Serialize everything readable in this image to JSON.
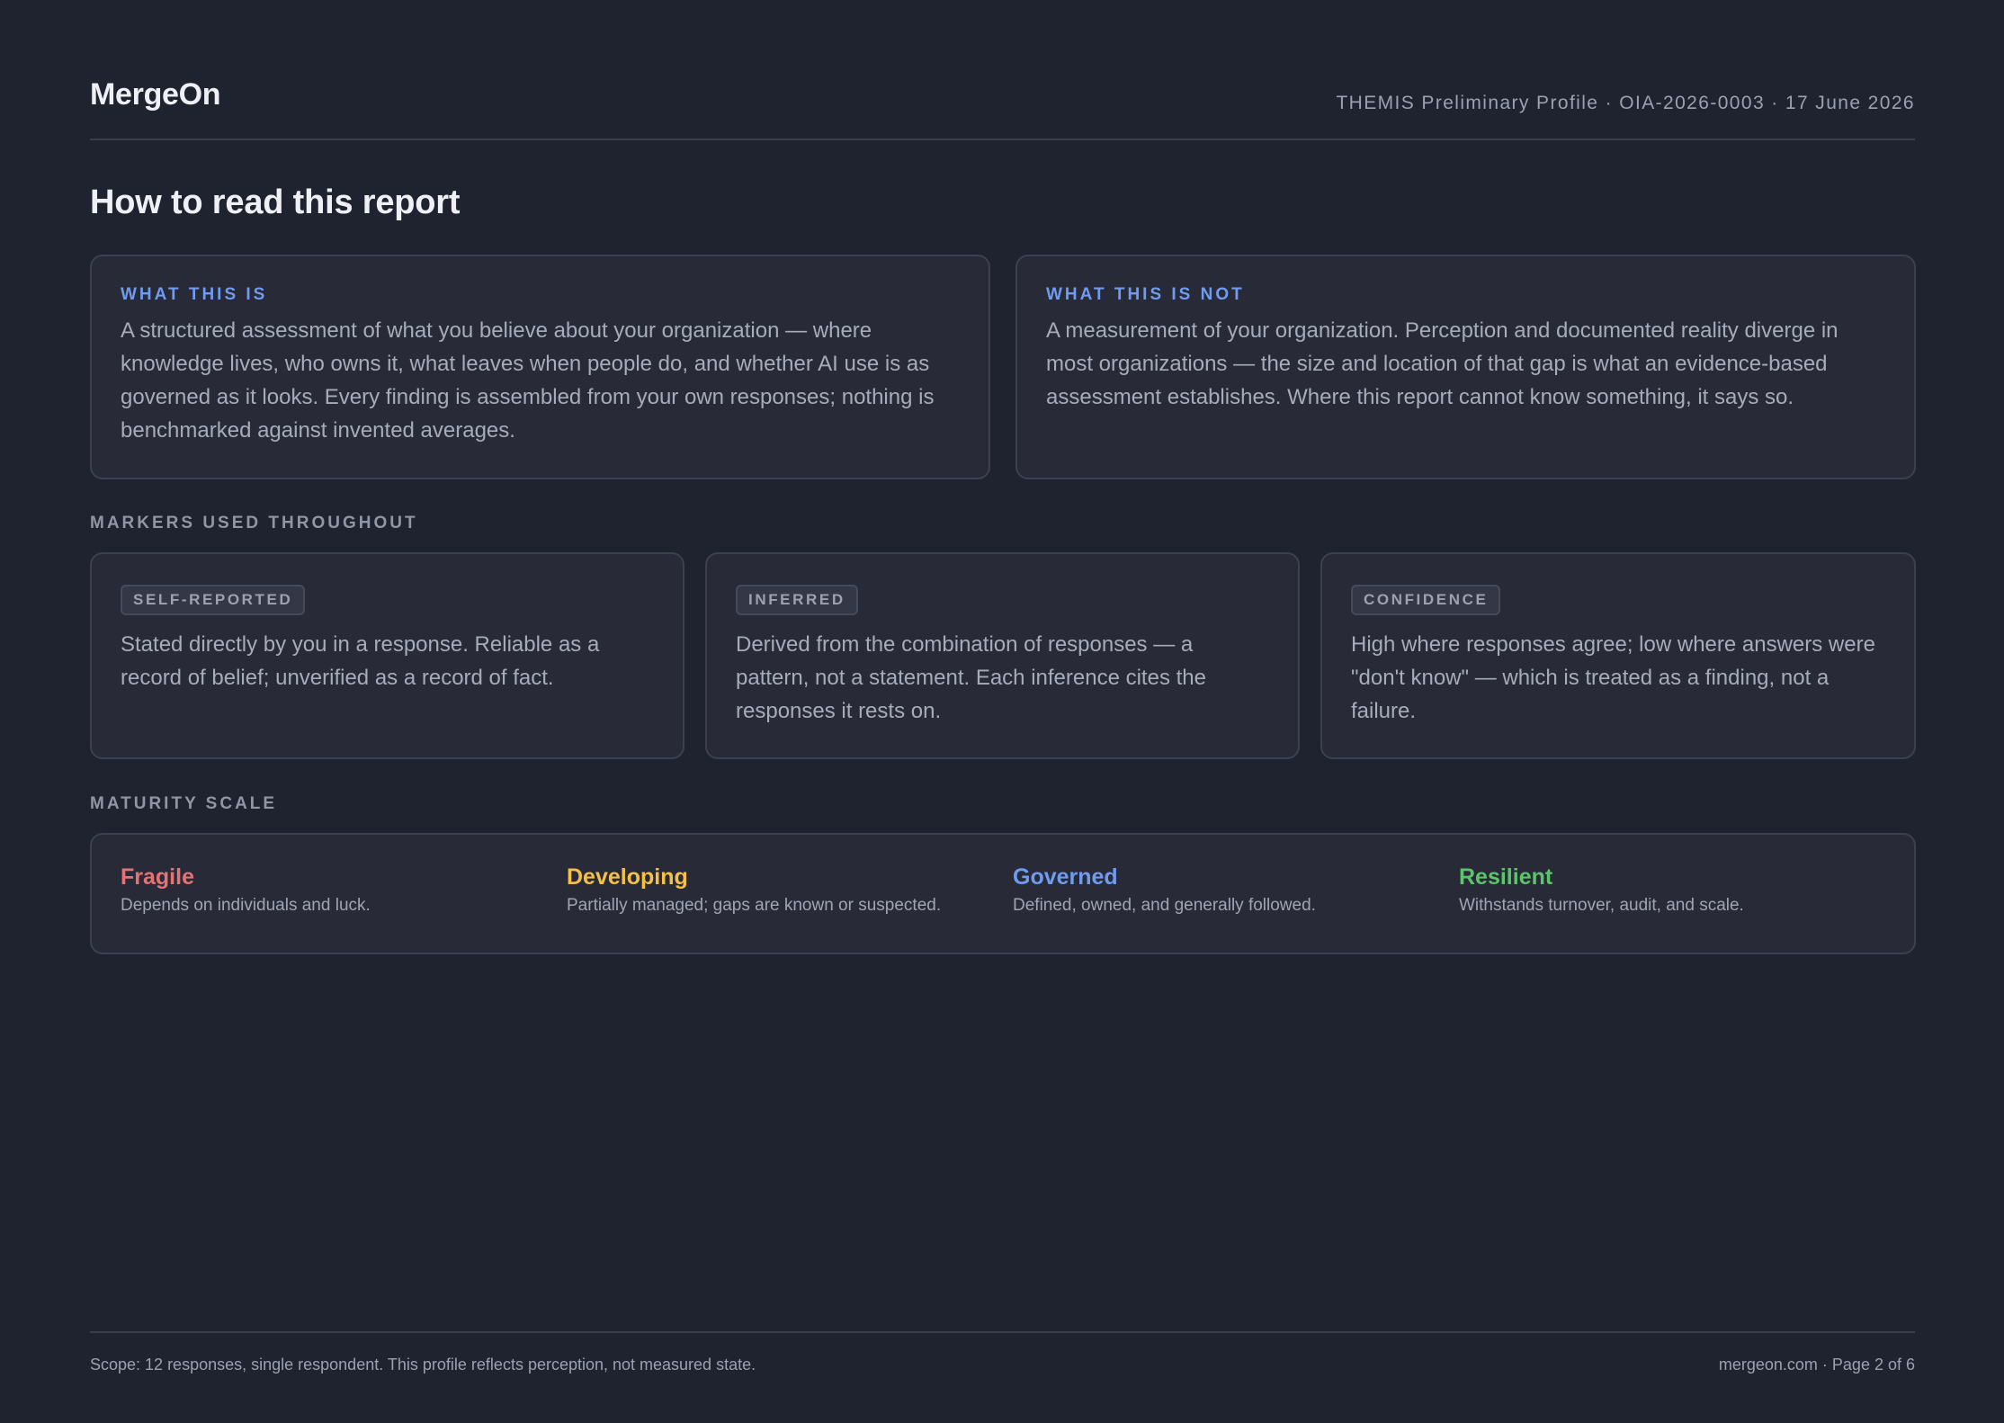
{
  "header": {
    "brand": "MergeOn",
    "meta": "THEMIS Preliminary Profile · OIA-2026-0003 · 17 June 2026"
  },
  "page_title": "How to read this report",
  "intro": {
    "is": {
      "label": "WHAT THIS IS",
      "text": "A structured assessment of what you believe about your organization — where knowledge lives, who owns it, what leaves when people do, and whether AI use is as governed as it looks. Every finding is assembled from your own responses; nothing is benchmarked against invented averages."
    },
    "is_not": {
      "label": "WHAT THIS IS NOT",
      "text": "A measurement of your organization. Perception and documented reality diverge in most organizations — the size and location of that gap is what an evidence-based assessment establishes. Where this report cannot know something, it says so."
    }
  },
  "markers": {
    "section_label": "MARKERS USED THROUGHOUT",
    "items": [
      {
        "tag": "SELF-REPORTED",
        "text": "Stated directly by you in a response. Reliable as a record of belief; unverified as a record of fact."
      },
      {
        "tag": "INFERRED",
        "text": "Derived from the combination of responses — a pattern, not a statement. Each inference cites the responses it rests on."
      },
      {
        "tag": "CONFIDENCE",
        "text": "High where responses agree; low where answers were \"don't know\" — which is treated as a finding, not a failure."
      }
    ]
  },
  "maturity": {
    "section_label": "MATURITY SCALE",
    "levels": [
      {
        "name": "Fragile",
        "desc": "Depends on individuals and luck.",
        "color": "#e57373"
      },
      {
        "name": "Developing",
        "desc": "Partially managed; gaps are known or suspected.",
        "color": "#f5c044"
      },
      {
        "name": "Governed",
        "desc": "Defined, owned, and generally followed.",
        "color": "#6f9cf0"
      },
      {
        "name": "Resilient",
        "desc": "Withstands turnover, audit, and scale.",
        "color": "#5cc46a"
      }
    ]
  },
  "footer": {
    "scope": "Scope: 12 responses, single respondent. This profile reflects perception, not measured state.",
    "page": "mergeon.com · Page 2 of 6"
  }
}
